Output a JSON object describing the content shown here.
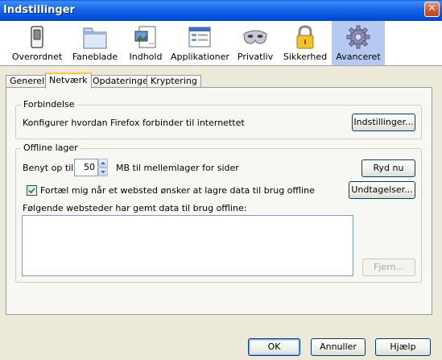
{
  "window": {
    "title": "Indstillinger"
  },
  "toolbar": {
    "items": [
      {
        "label": "Overordnet",
        "icon": "switch-icon"
      },
      {
        "label": "Faneblade",
        "icon": "tabs-icon"
      },
      {
        "label": "Indhold",
        "icon": "content-icon"
      },
      {
        "label": "Applikationer",
        "icon": "applications-icon"
      },
      {
        "label": "Privatliv",
        "icon": "mask-icon"
      },
      {
        "label": "Sikkerhed",
        "icon": "padlock-icon"
      },
      {
        "label": "Avanceret",
        "icon": "gear-icon",
        "selected": true
      }
    ]
  },
  "tabs": [
    {
      "label": "Generelt"
    },
    {
      "label": "Netværk",
      "active": true
    },
    {
      "label": "Opdateringer"
    },
    {
      "label": "Kryptering"
    }
  ],
  "connection": {
    "legend": "Forbindelse",
    "description": "Konfigurer hvordan Firefox forbinder til internettet",
    "settings_button": "Indstillinger..."
  },
  "offline": {
    "legend": "Offline lager",
    "use_up_to_label": "Benyt op til",
    "cache_size": "50",
    "cache_unit_label": "MB til mellemlager for sider",
    "clear_button": "Ryd nu",
    "notify_checked": true,
    "notify_label": "Fortæl mig når et websted ønsker at lagre data til brug offline",
    "exceptions_button": "Undtagelser...",
    "sites_label": "Følgende websteder har gemt data til brug offline:",
    "remove_button": "Fjern..."
  },
  "footer": {
    "ok_button": "OK",
    "cancel_button": "Annuller",
    "help_button": "Hjælp"
  },
  "colors": {
    "titlebar": "#0a5fe8",
    "selected_toolbar": "#b7c9f0",
    "dialog_bg": "#ece9d8",
    "active_tab_accent": "#ffc83c"
  }
}
